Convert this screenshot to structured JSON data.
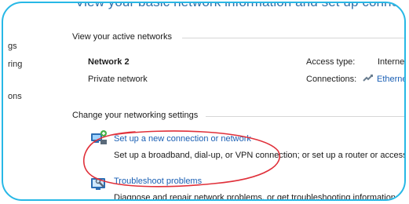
{
  "header": {
    "title": "View your basic network information and set up connections"
  },
  "sidebar": {
    "items": [
      {
        "label": "gs"
      },
      {
        "label": "ring"
      },
      {
        "label": "ons"
      }
    ]
  },
  "active_networks": {
    "heading": "View your active networks",
    "network_name": "Network 2",
    "network_profile": "Private network",
    "access_type_label": "Access type:",
    "access_type_value": "Internet",
    "connections_label": "Connections:",
    "connections_value": "Ethernet"
  },
  "settings": {
    "heading": "Change your networking settings",
    "tasks": [
      {
        "title": "Set up a new connection or network",
        "description": "Set up a broadband, dial-up, or VPN connection; or set up a router or access point.",
        "icon": "network-setup-icon"
      },
      {
        "title": "Troubleshoot problems",
        "description": "Diagnose and repair network problems, or get troubleshooting information.",
        "icon": "troubleshoot-icon"
      }
    ]
  },
  "colors": {
    "frame_border": "#27b8e6",
    "link": "#1a5fb4",
    "annotation": "#e0303a"
  }
}
